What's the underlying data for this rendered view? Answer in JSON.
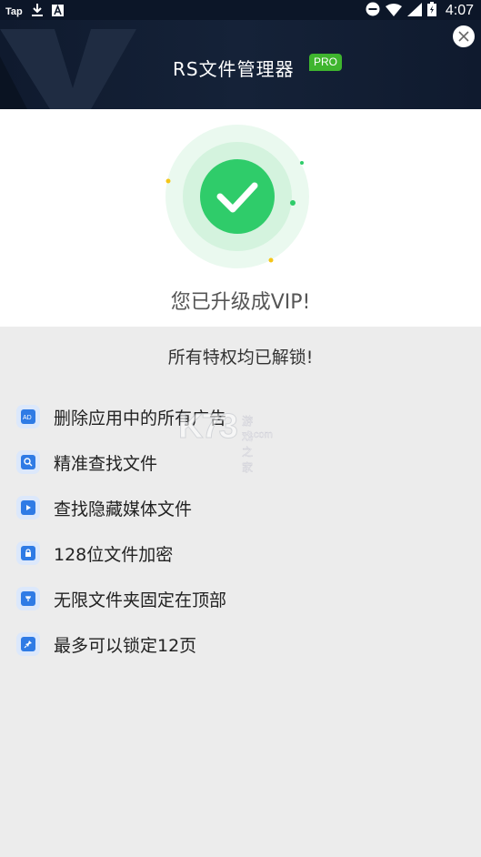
{
  "status_bar": {
    "left_app_label": "Tap",
    "time": "4:07",
    "icons": [
      "download-icon",
      "a-notification-icon",
      "do-not-disturb-icon",
      "wifi-icon",
      "signal-icon",
      "battery-icon"
    ]
  },
  "header": {
    "title": "RS文件管理器",
    "badge": "PRO",
    "close_icon": "close-icon"
  },
  "hero": {
    "status_text": "您已升级成VIP!",
    "icon": "check-icon",
    "accent_color": "#2ecc71"
  },
  "unlocked_text": "所有特权均已解锁!",
  "features": [
    {
      "label": "删除应用中的所有广告",
      "icon": "ad-icon"
    },
    {
      "label": "精准查找文件",
      "icon": "file-search-icon"
    },
    {
      "label": "查找隐藏媒体文件",
      "icon": "media-search-icon"
    },
    {
      "label": "128位文件加密",
      "icon": "lock-icon"
    },
    {
      "label": "无限文件夹固定在顶部",
      "icon": "folder-pin-icon"
    },
    {
      "label": "最多可以锁定12页",
      "icon": "pin-icon"
    }
  ],
  "watermark": {
    "main": "K73",
    "sub": "游戏之家",
    "domain": ".com"
  },
  "colors": {
    "header_bg": "#0f1a2e",
    "badge_green": "#3fb52e",
    "icon_blue": "#2f7be5"
  }
}
